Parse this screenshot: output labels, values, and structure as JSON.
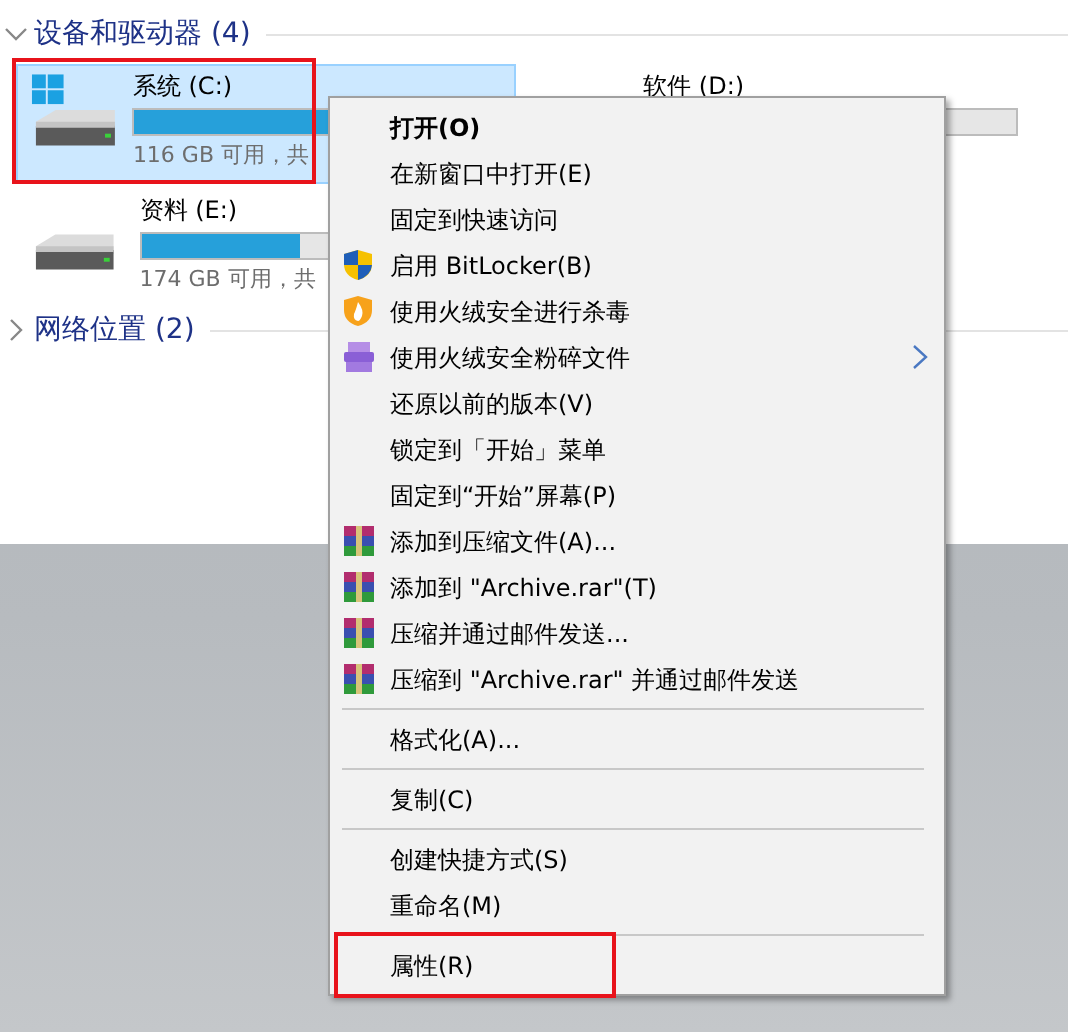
{
  "groups": [
    {
      "title": "设备和驱动器 (4)",
      "expanded": true
    },
    {
      "title": "网络位置 (2)",
      "expanded": false
    }
  ],
  "drives": [
    {
      "label": "系统 (C:)",
      "free": "116 GB 可用，共",
      "level": 0.55,
      "selected": true,
      "annotated": true,
      "kind": "windows"
    },
    {
      "label": "软件 (D:)",
      "selected": false,
      "kind": "hidden"
    },
    {
      "label": "资料 (E:)",
      "free": "174 GB 可用，共",
      "level": 0.43,
      "selected": false,
      "kind": "plain"
    }
  ],
  "context_menu": [
    {
      "kind": "plain",
      "label": "打开(O)",
      "default": true
    },
    {
      "kind": "plain",
      "label": "在新窗口中打开(E)"
    },
    {
      "kind": "plain",
      "label": "固定到快速访问"
    },
    {
      "kind": "bitlocker",
      "label": "启用 BitLocker(B)"
    },
    {
      "kind": "antivirus",
      "label": "使用火绒安全进行杀毒"
    },
    {
      "kind": "shred",
      "label": "使用火绒安全粉碎文件",
      "submenu": true
    },
    {
      "kind": "plain",
      "label": "还原以前的版本(V)"
    },
    {
      "kind": "plain",
      "label": "锁定到「开始」菜单"
    },
    {
      "kind": "plain",
      "label": "固定到“开始”屏幕(P)"
    },
    {
      "kind": "archive",
      "label": "添加到压缩文件(A)..."
    },
    {
      "kind": "archive",
      "label": "添加到 \"Archive.rar\"(T)"
    },
    {
      "kind": "archive",
      "label": "压缩并通过邮件发送..."
    },
    {
      "kind": "archive",
      "label": "压缩到 \"Archive.rar\" 并通过邮件发送"
    },
    {
      "kind": "separator"
    },
    {
      "kind": "plain",
      "label": "格式化(A)..."
    },
    {
      "kind": "separator"
    },
    {
      "kind": "plain",
      "label": "复制(C)"
    },
    {
      "kind": "separator"
    },
    {
      "kind": "plain",
      "label": "创建快捷方式(S)"
    },
    {
      "kind": "plain",
      "label": "重命名(M)"
    },
    {
      "kind": "separator"
    },
    {
      "kind": "plain",
      "label": "属性(R)",
      "annotated": true
    }
  ]
}
